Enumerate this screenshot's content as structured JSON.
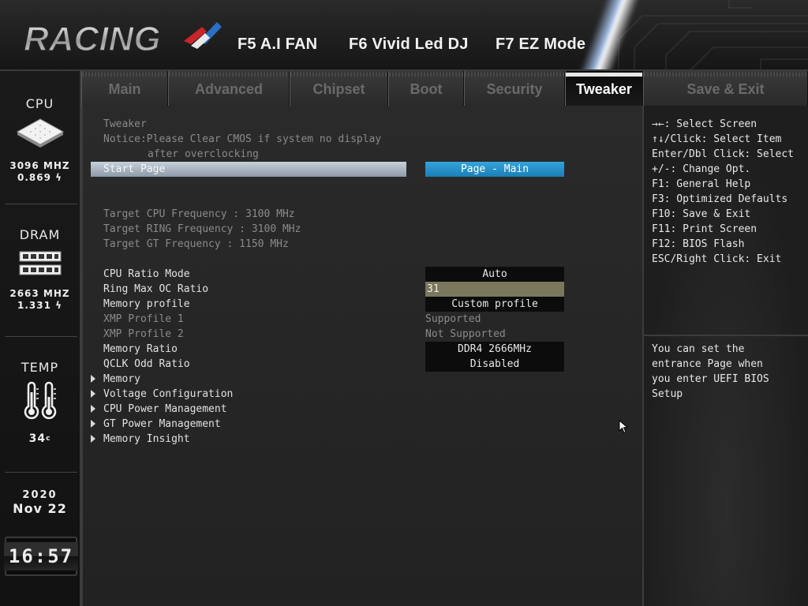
{
  "header": {
    "logo_text": "RACING",
    "fkeys": [
      {
        "label": "F5 A.I FAN"
      },
      {
        "label": "F6 Vivid Led DJ"
      },
      {
        "label": "F7 EZ Mode"
      }
    ]
  },
  "sidebar": {
    "cpu": {
      "title": "CPU",
      "freq": "3096 MHZ",
      "volt": "0.869"
    },
    "dram": {
      "title": "DRAM",
      "freq": "2663 MHZ",
      "volt": "1.331"
    },
    "temp": {
      "title": "TEMP",
      "value": "34"
    },
    "date": {
      "year": "2020",
      "month_day": "Nov 22"
    },
    "clock": "16:57"
  },
  "tabs": [
    {
      "label": "Main"
    },
    {
      "label": "Advanced"
    },
    {
      "label": "Chipset"
    },
    {
      "label": "Boot"
    },
    {
      "label": "Security"
    },
    {
      "label": "Tweaker"
    },
    {
      "label": "Save & Exit"
    }
  ],
  "active_tab": "Tweaker",
  "main": {
    "section_title": "Tweaker",
    "notice_line1": "Notice:Please Clear CMOS if system no display",
    "notice_line2": "after overclocking",
    "start_page": {
      "label": "Start Page",
      "value": "Page - Main"
    },
    "targets": [
      "Target CPU Frequency : 3100 MHz",
      "Target RING Frequency : 3100 MHz",
      "Target GT Frequency : 1150 MHz"
    ],
    "settings": [
      {
        "label": "CPU Ratio Mode",
        "value": "Auto"
      },
      {
        "label": "Ring Max OC Ratio",
        "value": "31"
      },
      {
        "label": "Memory profile",
        "value": "Custom profile"
      },
      {
        "label": "XMP Profile 1",
        "value": "Supported"
      },
      {
        "label": "XMP Profile 2",
        "value": "Not Supported"
      },
      {
        "label": "Memory Ratio",
        "value": "DDR4 2666MHz"
      },
      {
        "label": "QCLK Odd Ratio",
        "value": "Disabled"
      }
    ],
    "submenus": [
      "Memory",
      "Voltage Configuration",
      "CPU Power Management",
      "GT Power Management",
      "Memory Insight"
    ]
  },
  "help": {
    "keys": [
      "→←: Select Screen",
      "↑↓/Click: Select Item",
      "Enter/Dbl Click: Select",
      "+/-: Change Opt.",
      "F1: General Help",
      "F3: Optimized Defaults",
      "F10: Save & Exit",
      "F11: Print Screen",
      "F12: BIOS Flash",
      "ESC/Right Click: Exit"
    ],
    "description": [
      "You can set the",
      "entrance Page when",
      "you enter UEFI BIOS",
      "Setup"
    ]
  }
}
